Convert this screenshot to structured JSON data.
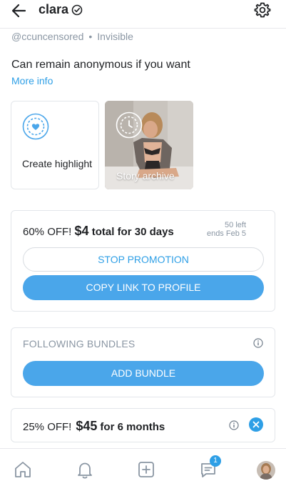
{
  "header": {
    "title": "clara",
    "back_icon": "arrow-left-icon",
    "verified_icon": "verified-check-icon",
    "settings_icon": "gear-icon"
  },
  "profile": {
    "username": "@ccuncensored",
    "separator": "•",
    "status": "Invisible",
    "about": "Can remain anonymous if you want",
    "more_info": "More info"
  },
  "stories": {
    "create_highlight": "Create highlight",
    "story_archive": "Story archive"
  },
  "promotion": {
    "discount": "60% OFF!",
    "price": "$4",
    "term": "total for 30 days",
    "left": "50 left",
    "ends": "ends Feb 5",
    "stop_label": "STOP PROMOTION",
    "copy_label": "COPY LINK TO PROFILE"
  },
  "bundles": {
    "title": "FOLLOWING BUNDLES",
    "add_label": "ADD BUNDLE"
  },
  "offer": {
    "discount": "25% OFF!",
    "price": "$45",
    "term": "for 6 months"
  },
  "nav": {
    "items": [
      "home-icon",
      "bell-icon",
      "add-post-icon",
      "messages-icon",
      "avatar"
    ],
    "messages_badge": "1"
  },
  "colors": {
    "accent": "#2e9fe6",
    "button_fill": "#4aa6ea",
    "muted_text": "#8a96a3",
    "border": "#e3e6ea"
  }
}
